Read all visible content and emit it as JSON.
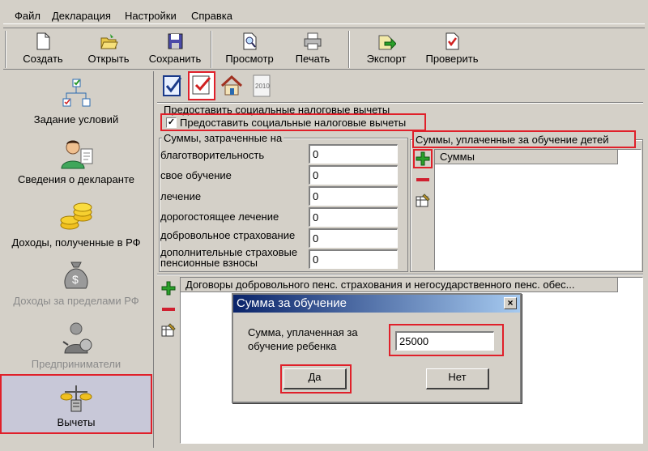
{
  "menu": [
    "Файл",
    "Декларация",
    "Настройки",
    "Справка"
  ],
  "toolbar": {
    "create": "Создать",
    "open": "Открыть",
    "save": "Сохранить",
    "preview": "Просмотр",
    "print": "Печать",
    "export": "Экспорт",
    "check": "Проверить"
  },
  "nav": [
    {
      "label": "Задание условий",
      "icon": "conditions-icon",
      "enabled": true
    },
    {
      "label": "Сведения о декларанте",
      "icon": "person-icon",
      "enabled": true
    },
    {
      "label": "Доходы, полученные в РФ",
      "icon": "coins-icon",
      "enabled": true
    },
    {
      "label": "Доходы за пределами РФ",
      "icon": "money-bag-icon",
      "enabled": false
    },
    {
      "label": "Предприниматели",
      "icon": "entrepreneur-icon",
      "enabled": false
    },
    {
      "label": "Вычеты",
      "icon": "deductions-icon",
      "enabled": true,
      "selected": true
    }
  ],
  "tabs_icons": [
    "standard-deductions-icon",
    "social-deductions-icon",
    "property-deductions-icon",
    "year-2010-icon"
  ],
  "tab_year": "2010",
  "social": {
    "group_title": "Предоставить социальные налоговые вычеты",
    "checkbox_label": "Предоставить социальные налоговые вычеты",
    "checkbox_checked": true,
    "sums_spent_title": "Суммы, затраченные на",
    "fields": [
      {
        "label": "благотворительность",
        "value": "0"
      },
      {
        "label": "свое обучение",
        "value": "0"
      },
      {
        "label": "лечение",
        "value": "0"
      },
      {
        "label": "дорогостоящее лечение",
        "value": "0"
      },
      {
        "label": "добровольное страхование",
        "value": "0"
      },
      {
        "label": "дополнительные страховые пенсионные взносы",
        "label_line1": "дополнительные страховые",
        "label_line2": "пенсионные взносы",
        "value": "0"
      }
    ],
    "children_title": "Суммы, уплаченные за обучение детей",
    "children_column": "Суммы",
    "contracts_column": "Договоры добровольного пенс. страхования и негосударственного пенс. обес..."
  },
  "dialog": {
    "title": "Сумма за обучение",
    "close": "×",
    "field_label_line1": "Сумма, уплаченная за",
    "field_label_line2": "обучение ребенка",
    "value": "25000",
    "ok": "Да",
    "cancel": "Нет"
  },
  "colors": {
    "highlight": "#e0202a",
    "window": "#d4d0c8",
    "title_start": "#0a246a",
    "title_end": "#a6caf0"
  }
}
